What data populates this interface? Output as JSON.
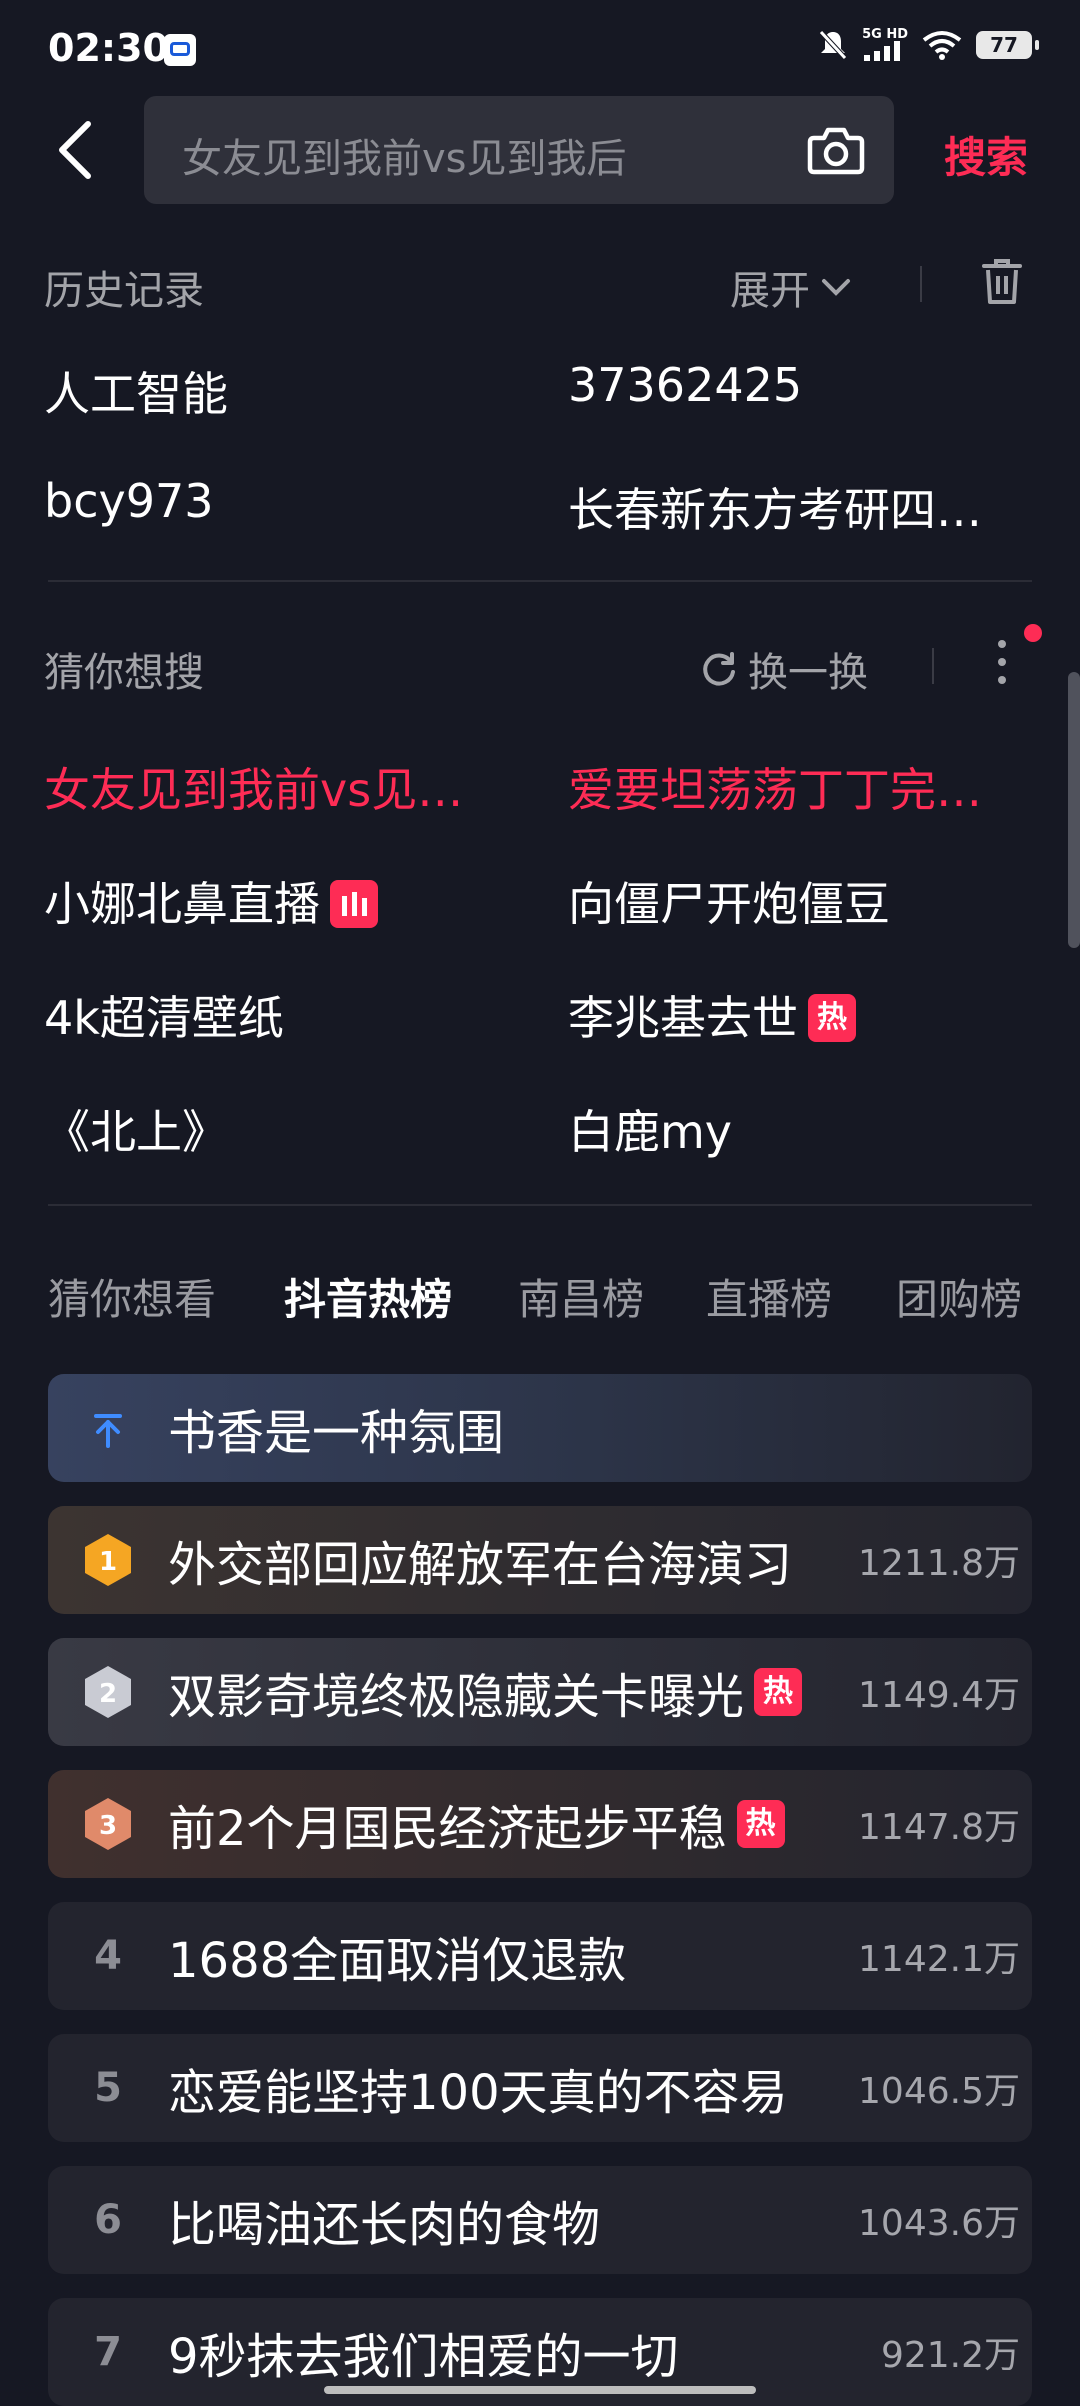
{
  "status_bar": {
    "time": "02:30",
    "network": "5G HD",
    "battery": "77"
  },
  "search": {
    "placeholder": "女友见到我前vs见到我后",
    "button_label": "搜索"
  },
  "history": {
    "title": "历史记录",
    "expand_label": "展开",
    "items": [
      "人工智能",
      "37362425",
      "bcy973",
      "长春新东方考研四…"
    ]
  },
  "guess": {
    "title": "猜你想搜",
    "refresh_label": "换一换",
    "items": [
      {
        "text": "女友见到我前vs见…",
        "hot": true
      },
      {
        "text": "爱要坦荡荡丁丁完…",
        "hot": true
      },
      {
        "text": "小娜北鼻直播",
        "badge": "live"
      },
      {
        "text": "向僵尸开炮僵豆"
      },
      {
        "text": "4k超清壁纸"
      },
      {
        "text": "李兆基去世",
        "badge": "热"
      },
      {
        "text": "《北上》"
      },
      {
        "text": "白鹿my"
      }
    ]
  },
  "tabs": [
    "猜你想看",
    "抖音热榜",
    "南昌榜",
    "直播榜",
    "团购榜"
  ],
  "active_tab": "抖音热榜",
  "hot_list": [
    {
      "rank": "",
      "pinned": true,
      "title": "书香是一种氛围",
      "heat": ""
    },
    {
      "rank": "1",
      "title": "外交部回应解放军在台海演习",
      "heat": "1211.8万"
    },
    {
      "rank": "2",
      "title": "双影奇境终极隐藏关卡曝光",
      "badge": "热",
      "heat": "1149.4万"
    },
    {
      "rank": "3",
      "title": "前2个月国民经济起步平稳",
      "badge": "热",
      "heat": "1147.8万"
    },
    {
      "rank": "4",
      "title": "1688全面取消仅退款",
      "heat": "1142.1万"
    },
    {
      "rank": "5",
      "title": "恋爱能坚持100天真的不容易",
      "heat": "1046.5万"
    },
    {
      "rank": "6",
      "title": "比喝油还长肉的食物",
      "heat": "1043.6万"
    },
    {
      "rank": "7",
      "title": "9秒抹去我们相爱的一切",
      "heat": "921.2万"
    }
  ],
  "colors": {
    "accent": "#fe2c55",
    "background": "#161823",
    "gold": "#f5a623",
    "silver": "#c9cbd3",
    "bronze": "#e08a6a"
  }
}
